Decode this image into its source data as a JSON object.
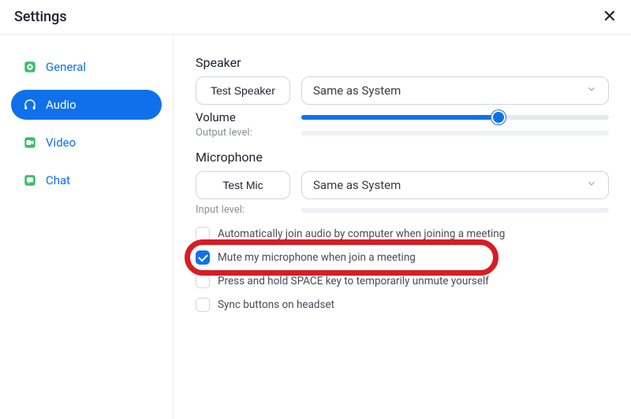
{
  "window": {
    "title": "Settings",
    "close_glyph": "✕"
  },
  "sidebar": {
    "items": [
      {
        "label": "General",
        "icon": "gear"
      },
      {
        "label": "Audio",
        "icon": "headphones"
      },
      {
        "label": "Video",
        "icon": "video"
      },
      {
        "label": "Chat",
        "icon": "chat"
      }
    ],
    "active_index": 1
  },
  "audio": {
    "speaker_heading": "Speaker",
    "test_speaker_label": "Test Speaker",
    "speaker_device": "Same as System",
    "volume_label": "Volume",
    "volume_percent": 64,
    "output_level_label": "Output level:",
    "mic_heading": "Microphone",
    "test_mic_label": "Test Mic",
    "mic_device": "Same as System",
    "input_level_label": "Input level:",
    "options": {
      "auto_join": {
        "label": "Automatically join audio by computer when joining a meeting",
        "checked": false
      },
      "mute_on_join": {
        "label": "Mute my microphone when join a meeting",
        "checked": true
      },
      "push_to_talk": {
        "label": "Press and hold SPACE key to temporarily unmute yourself",
        "checked": false
      },
      "sync_headset": {
        "label": "Sync buttons on headset",
        "checked": false
      }
    }
  }
}
